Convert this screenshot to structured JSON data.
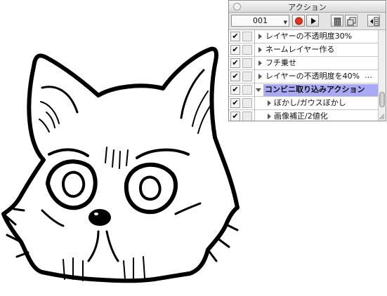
{
  "panel": {
    "title": "アクション",
    "action_set": "001",
    "toolbar_icons": [
      "record-icon",
      "play-icon",
      "trash-icon",
      "new-action-icon",
      "panel-menu-icon"
    ],
    "rows": [
      {
        "label": "レイヤーの不透明度30%",
        "checked": true,
        "expanded": false,
        "indent": 1
      },
      {
        "label": "ネームレイヤー作る",
        "checked": true,
        "expanded": false,
        "indent": 1
      },
      {
        "label": "フチ乗せ",
        "checked": true,
        "expanded": false,
        "indent": 1
      },
      {
        "label": "レイヤーの不透明度を40%",
        "checked": true,
        "expanded": false,
        "indent": 1,
        "ellipsis": "…"
      },
      {
        "label": "コンビニ取り込みアクション",
        "checked": true,
        "expanded": true,
        "selected": true,
        "indent": 0
      },
      {
        "label": "ぼかし/ガウスぼかし",
        "checked": true,
        "expanded": false,
        "indent": 2
      },
      {
        "label": "画像補正/2値化",
        "checked": true,
        "expanded": false,
        "indent": 2
      }
    ],
    "colors": {
      "selection": "#a9a9f5",
      "record": "#e2371f"
    }
  },
  "canvas": {
    "subject": "cat-face-line-drawing"
  }
}
